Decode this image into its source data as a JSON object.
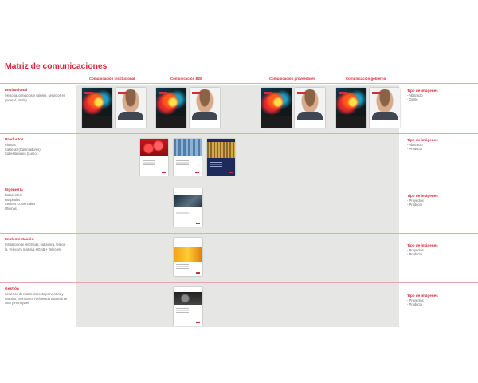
{
  "title": "Matriz de comunicaciones",
  "columns": [
    "Comunicación institucional",
    "Comunicación B2B",
    "Comunicación proveedores",
    "Comunicación gobierno"
  ],
  "rows": [
    {
      "title": "Institucional",
      "desc": "(Historia, principios  y valores, servicios en general, visión)",
      "tipo_title": "Tipo de imágenes",
      "tipo_items": [
        "- Abstracto",
        "- Gente"
      ]
    },
    {
      "title": "Productos",
      "desc": "Plantas\nCalderas (Calentadores)\nSubestaciones (Lumo)",
      "tipo_title": "Tipo de imágenes",
      "tipo_items": [
        "- Abstracto",
        "- Producto"
      ]
    },
    {
      "title": "Ingeniería",
      "desc": "Datacenters\nHospitales\nCentros Comerciales\nOficinas",
      "tipo_title": "Tipo de imágenes",
      "tipo_items": [
        "- Proyectos",
        "- Producto"
      ]
    },
    {
      "title": "Implementación",
      "desc": "Instalaciones eléctricas, hidráulica, teleco-\nla, Telecom, material HGAB + Telecom",
      "tipo_title": "Tipo de imágenes",
      "tipo_items": [
        "- Proyectos",
        "- Producto"
      ]
    },
    {
      "title": "Gestión",
      "desc": "Servicios de mantenimiento preventivo y\nreactivo, monitoreo. Referencia material de\nOtto y Honeywell",
      "tipo_title": "Tipo de imágenes",
      "tipo_items": [
        "- Proyectos",
        "- Producto"
      ]
    }
  ],
  "colors": {
    "accent": "#d72b3d",
    "panel": "#e6e6e4",
    "divider": "#e8a7ae"
  }
}
